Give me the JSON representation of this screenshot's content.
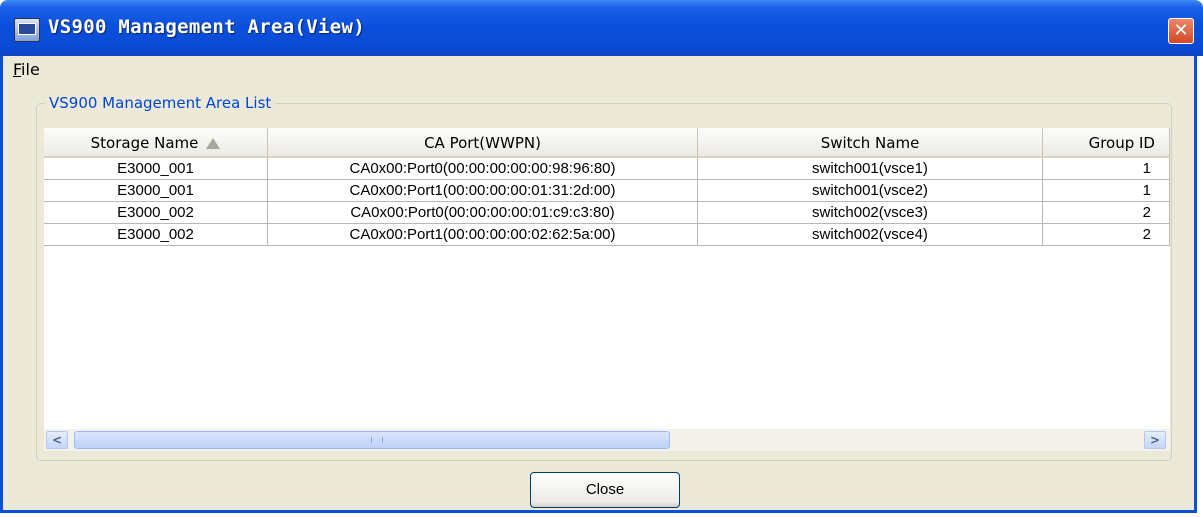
{
  "window": {
    "title": "VS900 Management Area(View)",
    "accent_color": "#0a4fd6",
    "close_icon": "close-icon"
  },
  "menu": {
    "file_mnemonic": "F",
    "file_rest": "ile"
  },
  "group": {
    "legend": "VS900 Management Area List"
  },
  "table": {
    "columns": [
      "Storage Name",
      "CA Port(WWPN)",
      "Switch Name",
      "Group ID"
    ],
    "sort_indicator": "sort-ascending-icon",
    "rows": [
      [
        "E3000_001",
        "CA0x00:Port0(00:00:00:00:00:98:96:80)",
        "switch001(vsce1)",
        "1"
      ],
      [
        "E3000_001",
        "CA0x00:Port1(00:00:00:00:01:31:2d:00)",
        "switch001(vsce2)",
        "1"
      ],
      [
        "E3000_002",
        "CA0x00:Port0(00:00:00:00:01:c9:c3:80)",
        "switch002(vsce3)",
        "2"
      ],
      [
        "E3000_002",
        "CA0x00:Port1(00:00:00:00:02:62:5a:00)",
        "switch002(vsce4)",
        "2"
      ]
    ]
  },
  "scrollbar": {
    "left_arrow": "<",
    "right_arrow": ">"
  },
  "buttons": {
    "close_label": "Close"
  }
}
